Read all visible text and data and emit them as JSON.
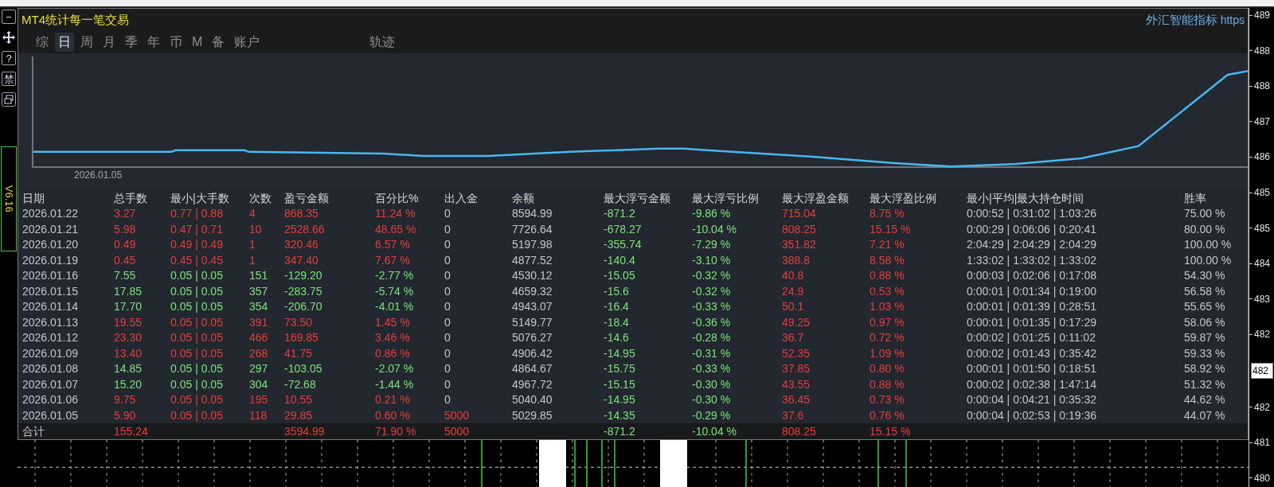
{
  "left_tools": [
    {
      "kind": "text",
      "label": "−"
    },
    {
      "kind": "move"
    },
    {
      "kind": "text",
      "label": "?"
    },
    {
      "kind": "text",
      "label": "禁"
    },
    {
      "kind": "window"
    }
  ],
  "version_label": "V6.16",
  "panel": {
    "title": "MT4统计每一笔交易",
    "brand": "外汇智能指标",
    "link": "https"
  },
  "tabs": [
    {
      "label": "综",
      "selected": false
    },
    {
      "label": "日",
      "selected": true
    },
    {
      "label": "周",
      "selected": false
    },
    {
      "label": "月",
      "selected": false
    },
    {
      "label": "季",
      "selected": false
    },
    {
      "label": "年",
      "selected": false
    },
    {
      "label": "币",
      "selected": false
    },
    {
      "label": "M",
      "selected": false
    },
    {
      "label": "备",
      "selected": false
    },
    {
      "label": "账户",
      "selected": false
    }
  ],
  "extra_tabs": [
    {
      "label": "轨迹",
      "selected": false
    }
  ],
  "chart": {
    "date_label": "2026.01.05"
  },
  "table": {
    "columns": [
      {
        "label": "日期",
        "kind": "plain"
      },
      {
        "label": "总手数",
        "kind": "result"
      },
      {
        "label": "最小|大手数",
        "kind": "result"
      },
      {
        "label": "次数",
        "kind": "result"
      },
      {
        "label": "盈亏金额",
        "kind": "result"
      },
      {
        "label": "百分比%",
        "kind": "result"
      },
      {
        "label": "出入金",
        "kind": "cash"
      },
      {
        "label": "余额",
        "kind": "plain"
      },
      {
        "label": "最大浮亏金额",
        "kind": "loss"
      },
      {
        "label": "最大浮亏比例",
        "kind": "loss"
      },
      {
        "label": "最大浮盈金额",
        "kind": "gain"
      },
      {
        "label": "最大浮盈比例",
        "kind": "gain"
      },
      {
        "label": "最小|平均|最大持仓时间",
        "kind": "plain"
      },
      {
        "label": "胜率",
        "kind": "plain"
      }
    ],
    "rows": [
      {
        "profit": true,
        "deposit": false,
        "cells": [
          "2026.01.22",
          "3.27",
          "0.77 | 0.88",
          "4",
          "868.35",
          "11.24 %",
          "0",
          "8594.99",
          "-871.2",
          "-9.86 %",
          "715.04",
          "8.75 %",
          "0:00:52 | 0:31:02 | 1:03:26",
          "75.00 %"
        ]
      },
      {
        "profit": true,
        "deposit": false,
        "cells": [
          "2026.01.21",
          "5.98",
          "0.47 | 0.71",
          "10",
          "2528.66",
          "48.65 %",
          "0",
          "7726.64",
          "-678.27",
          "-10.04 %",
          "808.25",
          "15.15 %",
          "0:00:29 | 0:06:06 | 0:20:41",
          "80.00 %"
        ]
      },
      {
        "profit": true,
        "deposit": false,
        "cells": [
          "2026.01.20",
          "0.49",
          "0.49 | 0.49",
          "1",
          "320.46",
          "6.57 %",
          "0",
          "5197.98",
          "-355.74",
          "-7.29 %",
          "351.82",
          "7.21 %",
          "2:04:29 | 2:04:29 | 2:04:29",
          "100.00 %"
        ]
      },
      {
        "profit": true,
        "deposit": false,
        "cells": [
          "2026.01.19",
          "0.45",
          "0.45 | 0.45",
          "1",
          "347.40",
          "7.67 %",
          "0",
          "4877.52",
          "-140.4",
          "-3.10 %",
          "388.8",
          "8.58 %",
          "1:33:02 | 1:33:02 | 1:33:02",
          "100.00 %"
        ]
      },
      {
        "profit": false,
        "deposit": false,
        "cells": [
          "2026.01.16",
          "7.55",
          "0.05 | 0.05",
          "151",
          "-129.20",
          "-2.77 %",
          "0",
          "4530.12",
          "-15.05",
          "-0.32 %",
          "40.8",
          "0.88 %",
          "0:00:03 | 0:02:06 | 0:17:08",
          "54.30 %"
        ]
      },
      {
        "profit": false,
        "deposit": false,
        "cells": [
          "2026.01.15",
          "17.85",
          "0.05 | 0.05",
          "357",
          "-283.75",
          "-5.74 %",
          "0",
          "4659.32",
          "-15.6",
          "-0.32 %",
          "24.9",
          "0.53 %",
          "0:00:01 | 0:01:34 | 0:19:00",
          "56.58 %"
        ]
      },
      {
        "profit": false,
        "deposit": false,
        "cells": [
          "2026.01.14",
          "17.70",
          "0.05 | 0.05",
          "354",
          "-206.70",
          "-4.01 %",
          "0",
          "4943.07",
          "-16.4",
          "-0.33 %",
          "50.1",
          "1.03 %",
          "0:00:01 | 0:01:39 | 0:28:51",
          "55.65 %"
        ]
      },
      {
        "profit": true,
        "deposit": false,
        "cells": [
          "2026.01.13",
          "19.55",
          "0.05 | 0.05",
          "391",
          "73.50",
          "1.45 %",
          "0",
          "5149.77",
          "-18.4",
          "-0.36 %",
          "49.25",
          "0.97 %",
          "0:00:01 | 0:01:35 | 0:17:29",
          "58.06 %"
        ]
      },
      {
        "profit": true,
        "deposit": false,
        "cells": [
          "2026.01.12",
          "23.30",
          "0.05 | 0.05",
          "466",
          "169.85",
          "3.46 %",
          "0",
          "5076.27",
          "-14.6",
          "-0.28 %",
          "36.7",
          "0.72 %",
          "0:00:02 | 0:01:25 | 0:11:02",
          "59.87 %"
        ]
      },
      {
        "profit": true,
        "deposit": false,
        "cells": [
          "2026.01.09",
          "13.40",
          "0.05 | 0.05",
          "268",
          "41.75",
          "0.86 %",
          "0",
          "4906.42",
          "-14.95",
          "-0.31 %",
          "52.35",
          "1.09 %",
          "0:00:02 | 0:01:43 | 0:35:42",
          "59.33 %"
        ]
      },
      {
        "profit": false,
        "deposit": false,
        "cells": [
          "2026.01.08",
          "14.85",
          "0.05 | 0.05",
          "297",
          "-103.05",
          "-2.07 %",
          "0",
          "4864.67",
          "-15.75",
          "-0.33 %",
          "37.85",
          "0.80 %",
          "0:00:01 | 0:01:50 | 0:18:51",
          "58.92 %"
        ]
      },
      {
        "profit": false,
        "deposit": false,
        "cells": [
          "2026.01.07",
          "15.20",
          "0.05 | 0.05",
          "304",
          "-72.68",
          "-1.44 %",
          "0",
          "4967.72",
          "-15.15",
          "-0.30 %",
          "43.55",
          "0.88 %",
          "0:00:02 | 0:02:38 | 1:47:14",
          "51.32 %"
        ]
      },
      {
        "profit": true,
        "deposit": false,
        "cells": [
          "2026.01.06",
          "9.75",
          "0.05 | 0.05",
          "195",
          "10.55",
          "0.21 %",
          "0",
          "5040.40",
          "-14.95",
          "-0.30 %",
          "36.45",
          "0.73 %",
          "0:00:04 | 0:04:21 | 0:35:32",
          "44.62 %"
        ]
      },
      {
        "profit": true,
        "deposit": true,
        "cells": [
          "2026.01.05",
          "5.90",
          "0.05 | 0.05",
          "118",
          "29.85",
          "0.60 %",
          "5000",
          "5029.85",
          "-14.35",
          "-0.29 %",
          "37.6",
          "0.76 %",
          "0:00:04 | 0:02:53 | 0:19:36",
          "44.07 %"
        ]
      }
    ],
    "total": {
      "profit": true,
      "deposit": true,
      "cells": [
        "合计",
        "155.24",
        null,
        null,
        "3594.99",
        "71.90 %",
        "5000",
        null,
        "-871.2",
        "-10.04 %",
        "808.25",
        "15.15 %",
        null,
        null
      ]
    }
  },
  "price_axis": [
    {
      "kind": "tick",
      "label": "489"
    },
    {
      "kind": "tick",
      "label": "488"
    },
    {
      "kind": "tick",
      "label": "488"
    },
    {
      "kind": "tick",
      "label": "487"
    },
    {
      "kind": "tick",
      "label": "486"
    },
    {
      "kind": "tick",
      "label": "485"
    },
    {
      "kind": "tick",
      "label": "485"
    },
    {
      "kind": "tick",
      "label": "484"
    },
    {
      "kind": "tick",
      "label": "483"
    },
    {
      "kind": "tick",
      "label": "482"
    },
    {
      "kind": "current",
      "label": "482"
    },
    {
      "kind": "tick",
      "label": "482"
    },
    {
      "kind": "tick",
      "label": "481"
    },
    {
      "kind": "tick",
      "label": "480"
    }
  ]
}
